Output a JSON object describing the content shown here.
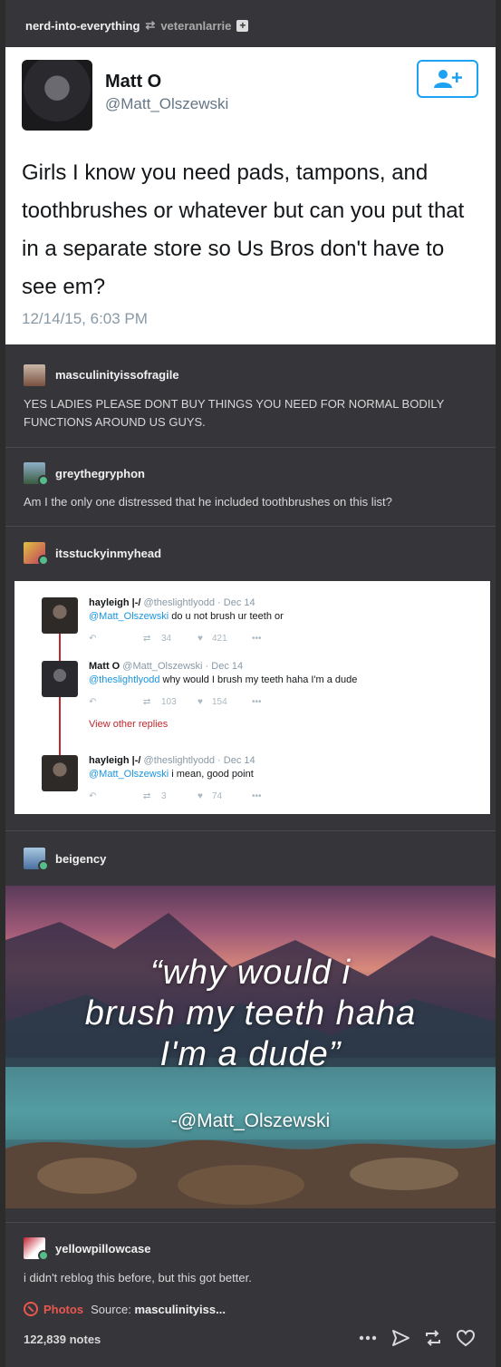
{
  "header": {
    "blog": "nerd-into-everything",
    "reblogged_from": "veteranlarrie"
  },
  "tweet": {
    "name": "Matt O",
    "handle": "@Matt_Olszewski",
    "text": "Girls I know you need pads, tampons, and toothbrushes or whatever but can you put that in a separate store so Us Bros don't have to see em?",
    "date": "12/14/15, 6:03 PM"
  },
  "reblogs": [
    {
      "user": "masculinityissofragile",
      "text": "YES LADIES PLEASE DONT BUY THINGS YOU NEED FOR NORMAL BODILY FUNCTIONS AROUND US GUYS."
    },
    {
      "user": "greythegryphon",
      "text": "Am I the only one distressed that he included toothbrushes on this list?"
    },
    {
      "user": "itsstuckyinmyhead",
      "text": ""
    },
    {
      "user": "beigency",
      "text": ""
    },
    {
      "user": "yellowpillowcase",
      "text": "i didn't reblog this before, but this got better."
    }
  ],
  "replies": [
    {
      "name": "hayleigh |-/",
      "handle": "@theslightlyodd",
      "date": "Dec 14",
      "mention": "@Matt_Olszewski",
      "text": "do u not brush ur teeth or",
      "retweets": "34",
      "likes": "421"
    },
    {
      "name": "Matt O",
      "handle": "@Matt_Olszewski",
      "date": "Dec 14",
      "mention": "@theslightlyodd",
      "text": "why would I brush my teeth haha I'm a dude",
      "retweets": "103",
      "likes": "154"
    },
    {
      "name": "hayleigh |-/",
      "handle": "@theslightlyodd",
      "date": "Dec 14",
      "mention": "@Matt_Olszewski",
      "text": "i mean, good point",
      "retweets": "3",
      "likes": "74"
    }
  ],
  "view_other_replies": "View other replies",
  "quote_image": {
    "line1": "“why would i",
    "line2": "brush my teeth haha",
    "line3": "I'm a dude”",
    "attribution": "-@Matt_Olszewski"
  },
  "footer": {
    "photos_label": "Photos",
    "source_label": "Source:",
    "source_value": "masculinityiss...",
    "notes": "122,839 notes"
  },
  "colors": {
    "accent_red": "#e9574f",
    "twitter_blue": "#1da1f2",
    "thread_red": "#c1272d"
  }
}
